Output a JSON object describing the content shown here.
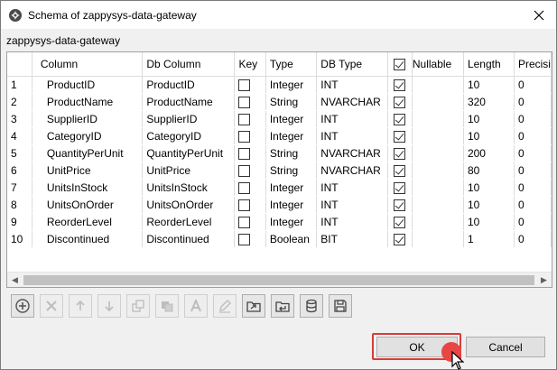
{
  "window": {
    "title": "Schema of zappysys-data-gateway",
    "app_icon": "gear-icon",
    "close_icon": "close-icon"
  },
  "section_label": "zappysys-data-gateway",
  "grid": {
    "headers": {
      "rownum": "",
      "column": "Column",
      "db_column": "Db Column",
      "key": "Key",
      "type": "Type",
      "db_type": "DB Type",
      "nullable_checked": true,
      "nullable": "Nullable",
      "length": "Length",
      "precision": "Precisi"
    },
    "rows": [
      {
        "num": "1",
        "column": "ProductID",
        "db_column": "ProductID",
        "key": false,
        "type": "Integer",
        "db_type": "INT",
        "nullable": true,
        "length": "10",
        "precision": "0"
      },
      {
        "num": "2",
        "column": "ProductName",
        "db_column": "ProductName",
        "key": false,
        "type": "String",
        "db_type": "NVARCHAR",
        "nullable": true,
        "length": "320",
        "precision": "0"
      },
      {
        "num": "3",
        "column": "SupplierID",
        "db_column": "SupplierID",
        "key": false,
        "type": "Integer",
        "db_type": "INT",
        "nullable": true,
        "length": "10",
        "precision": "0"
      },
      {
        "num": "4",
        "column": "CategoryID",
        "db_column": "CategoryID",
        "key": false,
        "type": "Integer",
        "db_type": "INT",
        "nullable": true,
        "length": "10",
        "precision": "0"
      },
      {
        "num": "5",
        "column": "QuantityPerUnit",
        "db_column": "QuantityPerUnit",
        "key": false,
        "type": "String",
        "db_type": "NVARCHAR",
        "nullable": true,
        "length": "200",
        "precision": "0"
      },
      {
        "num": "6",
        "column": "UnitPrice",
        "db_column": "UnitPrice",
        "key": false,
        "type": "String",
        "db_type": "NVARCHAR",
        "nullable": true,
        "length": "80",
        "precision": "0"
      },
      {
        "num": "7",
        "column": "UnitsInStock",
        "db_column": "UnitsInStock",
        "key": false,
        "type": "Integer",
        "db_type": "INT",
        "nullable": true,
        "length": "10",
        "precision": "0"
      },
      {
        "num": "8",
        "column": "UnitsOnOrder",
        "db_column": "UnitsOnOrder",
        "key": false,
        "type": "Integer",
        "db_type": "INT",
        "nullable": true,
        "length": "10",
        "precision": "0"
      },
      {
        "num": "9",
        "column": "ReorderLevel",
        "db_column": "ReorderLevel",
        "key": false,
        "type": "Integer",
        "db_type": "INT",
        "nullable": true,
        "length": "10",
        "precision": "0"
      },
      {
        "num": "10",
        "column": "Discontinued",
        "db_column": "Discontinued",
        "key": false,
        "type": "Boolean",
        "db_type": "BIT",
        "nullable": true,
        "length": "1",
        "precision": "0"
      }
    ]
  },
  "toolbar": [
    {
      "name": "add-row-button",
      "icon": "plus-circle-icon",
      "enabled": true
    },
    {
      "name": "delete-row-button",
      "icon": "x-icon",
      "enabled": false
    },
    {
      "name": "move-up-button",
      "icon": "arrow-up-icon",
      "enabled": false
    },
    {
      "name": "move-down-button",
      "icon": "arrow-down-icon",
      "enabled": false
    },
    {
      "name": "copy-button",
      "icon": "copy-icon",
      "enabled": false
    },
    {
      "name": "paste-button",
      "icon": "paste-icon",
      "enabled": false
    },
    {
      "name": "rename-button",
      "icon": "letter-a-icon",
      "enabled": false
    },
    {
      "name": "edit-button",
      "icon": "pencil-icon",
      "enabled": false
    },
    {
      "name": "export-button",
      "icon": "folder-export-icon",
      "enabled": true
    },
    {
      "name": "import-button",
      "icon": "folder-import-icon",
      "enabled": true
    },
    {
      "name": "database-button",
      "icon": "database-icon",
      "enabled": true
    },
    {
      "name": "save-button",
      "icon": "save-icon",
      "enabled": true
    }
  ],
  "buttons": {
    "ok": "OK",
    "cancel": "Cancel"
  },
  "colors": {
    "highlight": "#d93b3b",
    "cursor_dot": "#e84545"
  }
}
